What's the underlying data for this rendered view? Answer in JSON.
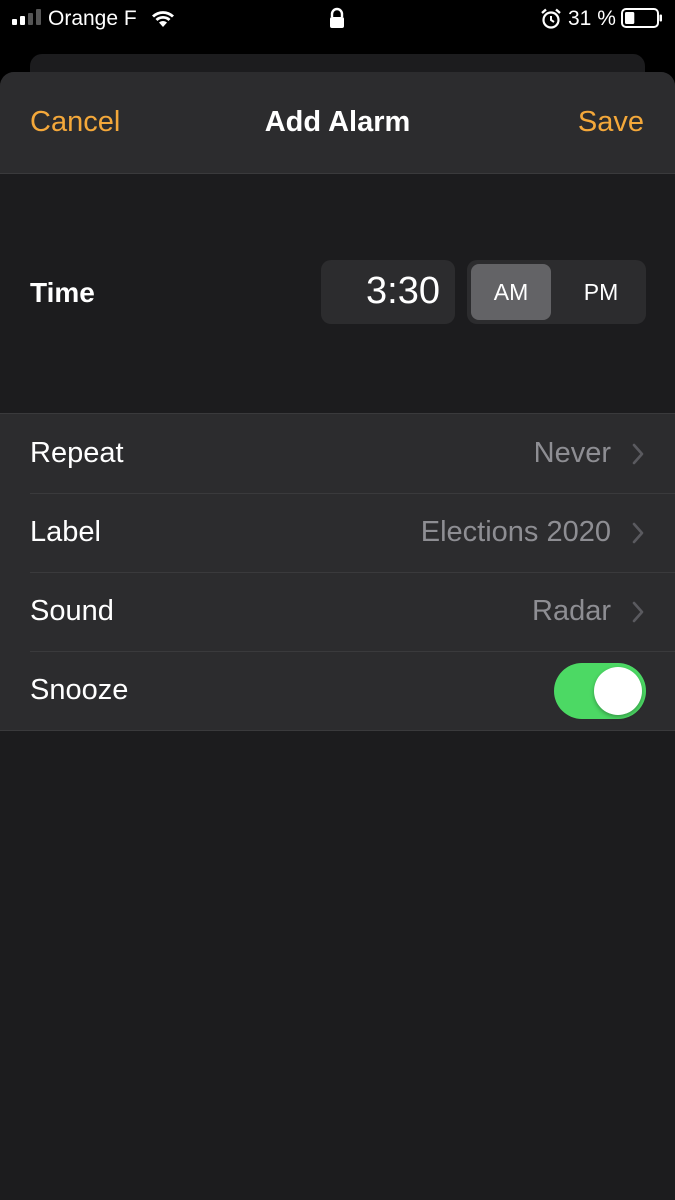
{
  "status_bar": {
    "carrier": "Orange F",
    "battery_percent": "31 %",
    "battery_level": 0.31,
    "icons": [
      "signal-icon",
      "wifi-icon",
      "lock-icon",
      "alarm-icon",
      "battery-icon"
    ]
  },
  "navbar": {
    "cancel_label": "Cancel",
    "title": "Add Alarm",
    "save_label": "Save"
  },
  "time": {
    "label": "Time",
    "value": "3:30",
    "am_label": "AM",
    "pm_label": "PM",
    "selected": "AM"
  },
  "settings": {
    "repeat": {
      "label": "Repeat",
      "value": "Never"
    },
    "alarm_label": {
      "label": "Label",
      "value": "Elections 2020"
    },
    "sound": {
      "label": "Sound",
      "value": "Radar"
    },
    "snooze": {
      "label": "Snooze",
      "enabled": true
    }
  },
  "colors": {
    "accent": "#f4a83a",
    "toggle_on": "#4cd964",
    "sheet_bg": "#1c1c1e",
    "cell_bg": "#2c2c2e",
    "secondary_text": "#8e8e93"
  }
}
